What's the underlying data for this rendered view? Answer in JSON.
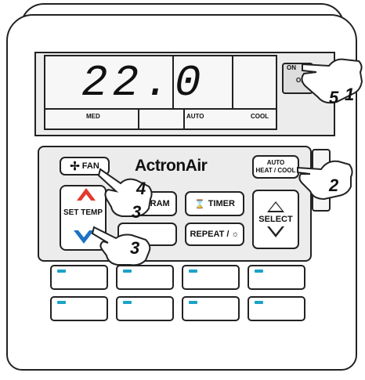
{
  "display": {
    "temperature": "22.0",
    "fan_speed": "MED",
    "mode_auto": "AUTO",
    "mode": "COOL"
  },
  "power_switch": {
    "on_label": "ON",
    "off_label": "OFF"
  },
  "brand": "ActronAir",
  "buttons": {
    "fan": "FAN",
    "auto_line1": "AUTO",
    "auto_line2": "HEAT / COOL",
    "set_temp": "SET TEMP",
    "program": "PROGRAM",
    "timer": "TIMER",
    "repeat": "REPEAT /",
    "select": "SELECT"
  },
  "zones": [
    "",
    "",
    "",
    "",
    "",
    "",
    "",
    ""
  ],
  "callouts": [
    "1",
    "5",
    "2",
    "4",
    "3",
    "3"
  ],
  "colors": {
    "up_arrow": "#e23b2e",
    "down_arrow": "#1d72c4",
    "zone_led": "#1aa3c6"
  }
}
